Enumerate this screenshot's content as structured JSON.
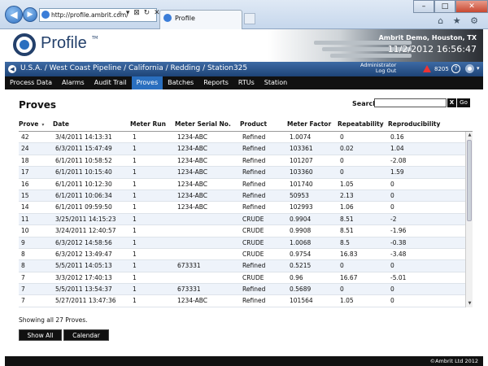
{
  "browser": {
    "url": "http://profile.ambrit.com/",
    "tab_title": "Profile",
    "address_tools": "⌕ ▾ ⊠ ↻ ✕",
    "minimize": "–",
    "maximize": "□",
    "close": "✕",
    "back": "◀",
    "forward": "▶",
    "tool_icons": "⌂ ★ ⚙"
  },
  "header": {
    "logo_text": "Profile",
    "logo_tm": "TM",
    "company": "Ambrit Demo, Houston, TX",
    "datetime": "11/2/2012  16:56:47"
  },
  "breadcrumb": {
    "back_icon": "◀",
    "path": "U.S.A. / West Coast Pipeline / California / Redding / Station325",
    "user": "Administrator",
    "logout": "Log Out",
    "alert_count": "8205",
    "help": "?",
    "menu_caret": "▾"
  },
  "nav": {
    "items": [
      "Process Data",
      "Alarms",
      "Audit Trail",
      "Proves",
      "Batches",
      "Reports",
      "RTUs",
      "Station"
    ],
    "active": "Proves"
  },
  "page": {
    "title": "Proves",
    "search_label": "Search:",
    "search_value": "",
    "search_clear": "X",
    "search_go": "Go",
    "showing": "Showing all 27 Proves.",
    "show_all": "Show All",
    "calendar": "Calendar"
  },
  "table": {
    "columns": [
      "Prove",
      "Date",
      "Meter Run",
      "Meter Serial No.",
      "Product",
      "Meter Factor",
      "Repeatability",
      "Reproducibility"
    ],
    "sort_caret": "▾",
    "rows": [
      [
        "42",
        "3/4/2011 14:13:31",
        "1",
        "1234-ABC",
        "Refined",
        "1.0074",
        "0",
        "0.16"
      ],
      [
        "24",
        "6/3/2011 15:47:49",
        "1",
        "1234-ABC",
        "Refined",
        "103361",
        "0.02",
        "1.04"
      ],
      [
        "18",
        "6/1/2011 10:58:52",
        "1",
        "1234-ABC",
        "Refined",
        "101207",
        "0",
        "-2.08"
      ],
      [
        "17",
        "6/1/2011 10:15:40",
        "1",
        "1234-ABC",
        "Refined",
        "103360",
        "0",
        "1.59"
      ],
      [
        "16",
        "6/1/2011 10:12:30",
        "1",
        "1234-ABC",
        "Refined",
        "101740",
        "1.05",
        "0"
      ],
      [
        "15",
        "6/1/2011 10:06:34",
        "1",
        "1234-ABC",
        "Refined",
        "50953",
        "2.13",
        "0"
      ],
      [
        "14",
        "6/1/2011 09:59:50",
        "1",
        "1234-ABC",
        "Refined",
        "102993",
        "1.06",
        "0"
      ],
      [
        "11",
        "3/25/2011 14:15:23",
        "1",
        "",
        "CRUDE",
        "0.9904",
        "8.51",
        "-2"
      ],
      [
        "10",
        "3/24/2011 12:40:57",
        "1",
        "",
        "CRUDE",
        "0.9908",
        "8.51",
        "-1.96"
      ],
      [
        "9",
        "6/3/2012 14:58:56",
        "1",
        "",
        "CRUDE",
        "1.0068",
        "8.5",
        "-0.38"
      ],
      [
        "8",
        "6/3/2012 13:49:47",
        "1",
        "",
        "CRUDE",
        "0.9754",
        "16.83",
        "-3.48"
      ],
      [
        "8",
        "5/5/2011 14:05:13",
        "1",
        "673331",
        " Refined",
        "0.5215",
        "0",
        "0"
      ],
      [
        "7",
        "3/3/2012 17:40:13",
        "1",
        "",
        "CRUDE",
        "0.96",
        "16.67",
        "-5.01"
      ],
      [
        "7",
        "5/5/2011 13:54:37",
        "1",
        "673331",
        " Refined",
        "0.5689",
        "0",
        "0"
      ],
      [
        "7",
        "5/27/2011 13:47:36",
        "1",
        "1234-ABC",
        "Refined",
        "101564",
        "1.05",
        "0"
      ]
    ]
  },
  "footer": {
    "copyright": "©Ambrit Ltd 2012"
  },
  "colors": {
    "accent": "#2a6fbf",
    "nav_bg": "#111111",
    "crumb_bg": "#1e4477"
  }
}
